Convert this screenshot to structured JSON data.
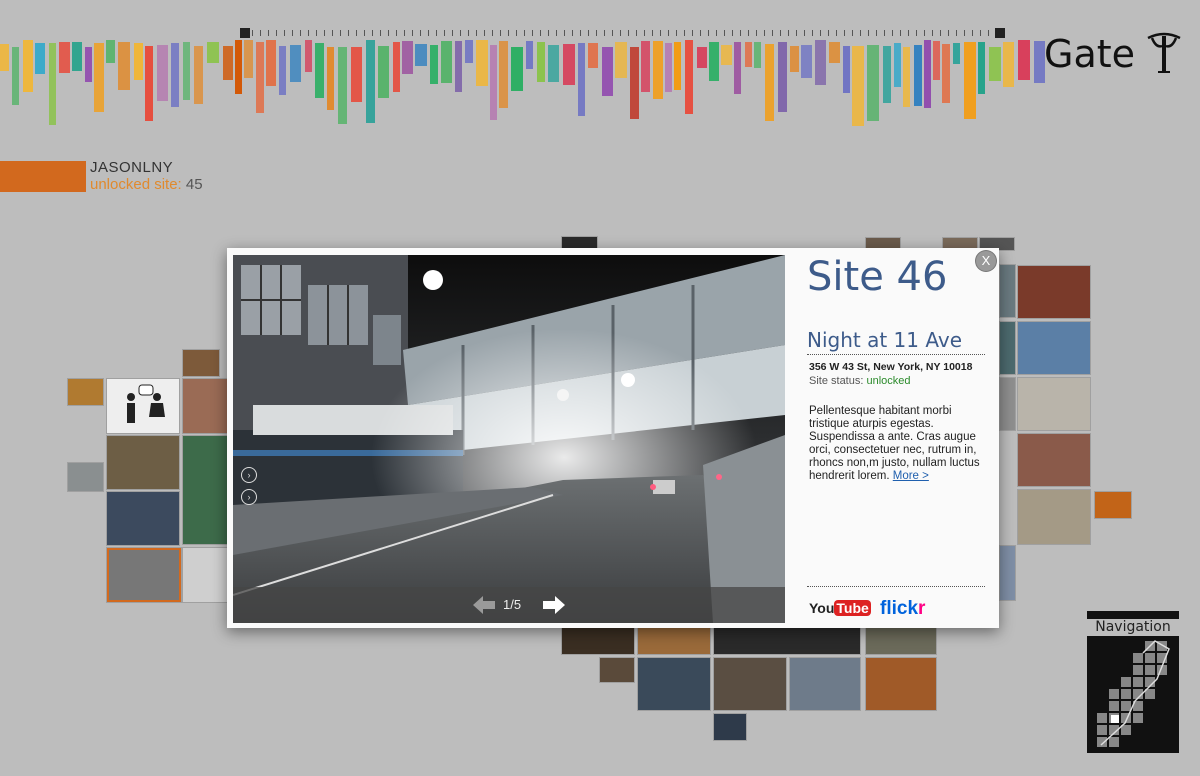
{
  "header": {
    "logo_text": "Gate",
    "bar_colors": [
      "#b57ab0",
      "#3aa9c9",
      "#e5673a",
      "#8bc34a",
      "#f2b632",
      "#7a5ea8",
      "#d83a57",
      "#2f7fbf",
      "#57b36a",
      "#e08a2e",
      "#9b4f9e",
      "#2aa198",
      "#c0392b",
      "#f39c12",
      "#6c71c4",
      "#16a085",
      "#d35400",
      "#8e44ad",
      "#27ae60",
      "#e74c3c"
    ]
  },
  "user": {
    "name": "JASONLNY",
    "unlocked_label": "unlocked site:",
    "unlocked_count": "45"
  },
  "modal": {
    "site_title": "Site 46",
    "site_name": "Night at 11 Ave",
    "address": "356 W 43 St, New York, NY 10018",
    "status_label": "Site status:",
    "status_value": "unlocked",
    "description": "Pellentesque habitant morbi tristique aturpis egestas. Suspendissa a ante. Cras augue orci, consectetuer nec, rutrum in, rhoncs non,m justo, nullam luctus hendrerit lorem.",
    "more_link": "More >",
    "pager": "1/5",
    "close_label": "X",
    "youtube_label_1": "You",
    "youtube_label_2": "Tube",
    "flickr_label_1": "flick",
    "flickr_label_2": "r"
  },
  "navigation": {
    "label": "Navigation"
  }
}
